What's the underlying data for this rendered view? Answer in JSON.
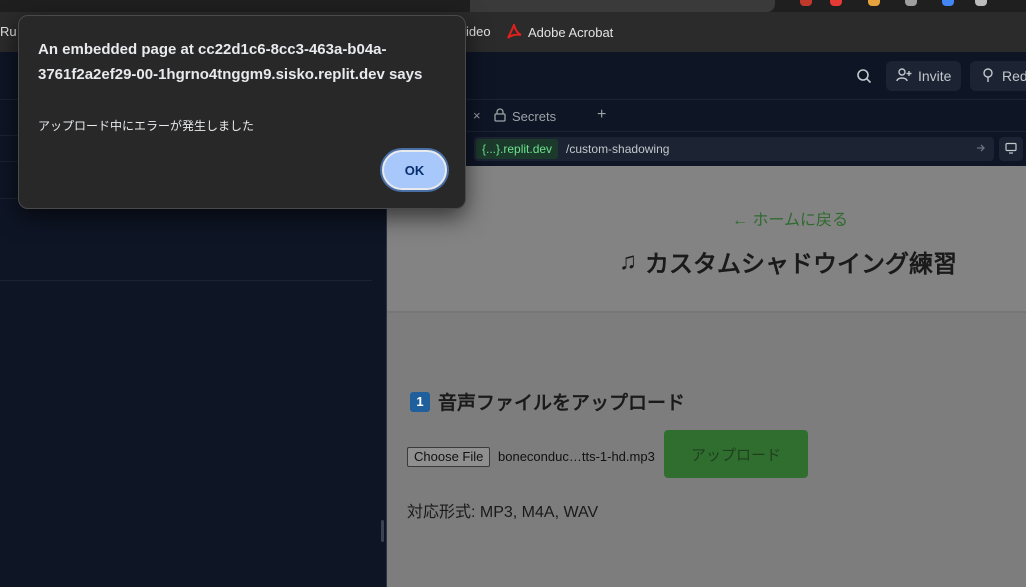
{
  "browser": {
    "bookmarks": [
      {
        "label": "Ru"
      },
      {
        "label": "ideo"
      },
      {
        "label": "Adobe Acrobat",
        "icon": "adobe-acrobat-icon"
      }
    ]
  },
  "workspace": {
    "header": {
      "search_icon": "search-icon",
      "invite_label": "Invite",
      "next_label": "Red"
    },
    "pane_tabs": {
      "secrets_label": "Secrets",
      "close_glyph": "×",
      "add_glyph": "+"
    },
    "url_bar": {
      "domain": "{...}.replit.dev",
      "path": "/custom-shadowing"
    }
  },
  "webview": {
    "back_link": "← ホームに戻る",
    "page_title": "カスタムシャドウイング練習",
    "page_title_icon": "♫",
    "section_number": "1",
    "section_title": "音声ファイルをアップロード",
    "choose_file_label": "Choose File",
    "file_name": "boneconduc…tts-1-hd.mp3",
    "upload_button_label": "アップロード",
    "formats_text": "対応形式: MP3, M4A, WAV",
    "colors": {
      "upload_button": "#2e8b2e",
      "link": "#2e7d32"
    }
  },
  "dialog": {
    "title": "An embedded page at cc22d1c6-8cc3-463a-b04a-3761f2a2ef29-00-1hgrno4tnggm9.sisko.replit.dev says",
    "message": "アップロード中にエラーが発生しました",
    "ok_label": "OK"
  }
}
